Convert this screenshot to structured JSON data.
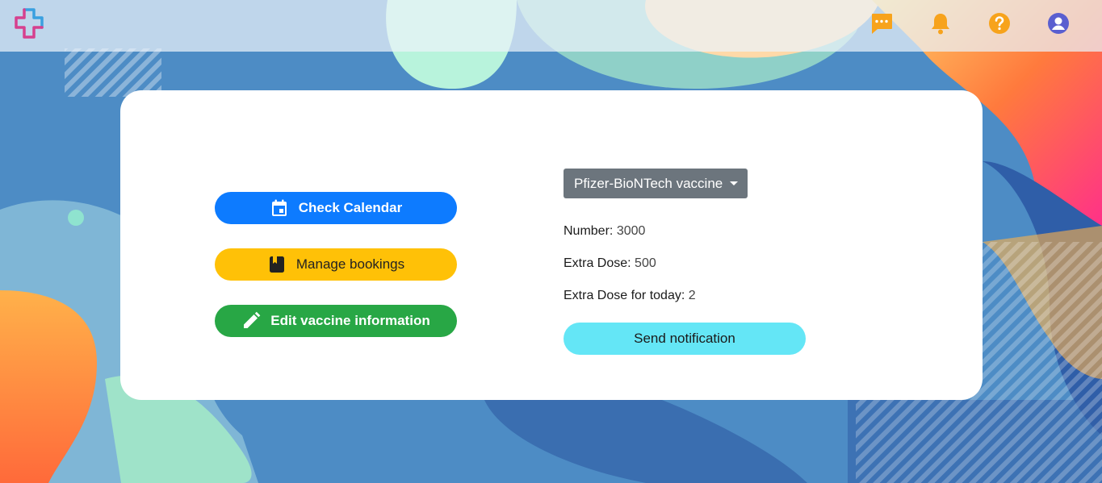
{
  "header": {
    "icons": [
      "logo-icon",
      "chat-icon",
      "bell-icon",
      "help-icon",
      "account-icon"
    ]
  },
  "actions": {
    "check_calendar": "Check Calendar",
    "manage_bookings": "Manage bookings",
    "edit_vaccine": "Edit vaccine information"
  },
  "vaccine": {
    "selected": "Pfizer-BioNTech vaccine",
    "number_label": "Number:",
    "number_value": "3000",
    "extra_label": "Extra Dose:",
    "extra_value": "500",
    "today_label": "Extra Dose for today:",
    "today_value": "2",
    "send_label": "Send notification"
  },
  "colors": {
    "primary": "#0d7bff",
    "warning": "#ffc107",
    "success": "#28a745",
    "secondary": "#6c757d",
    "info": "#64e6f6",
    "header_icon_orange": "#f7a31c",
    "account_icon": "#5a5fd0"
  }
}
